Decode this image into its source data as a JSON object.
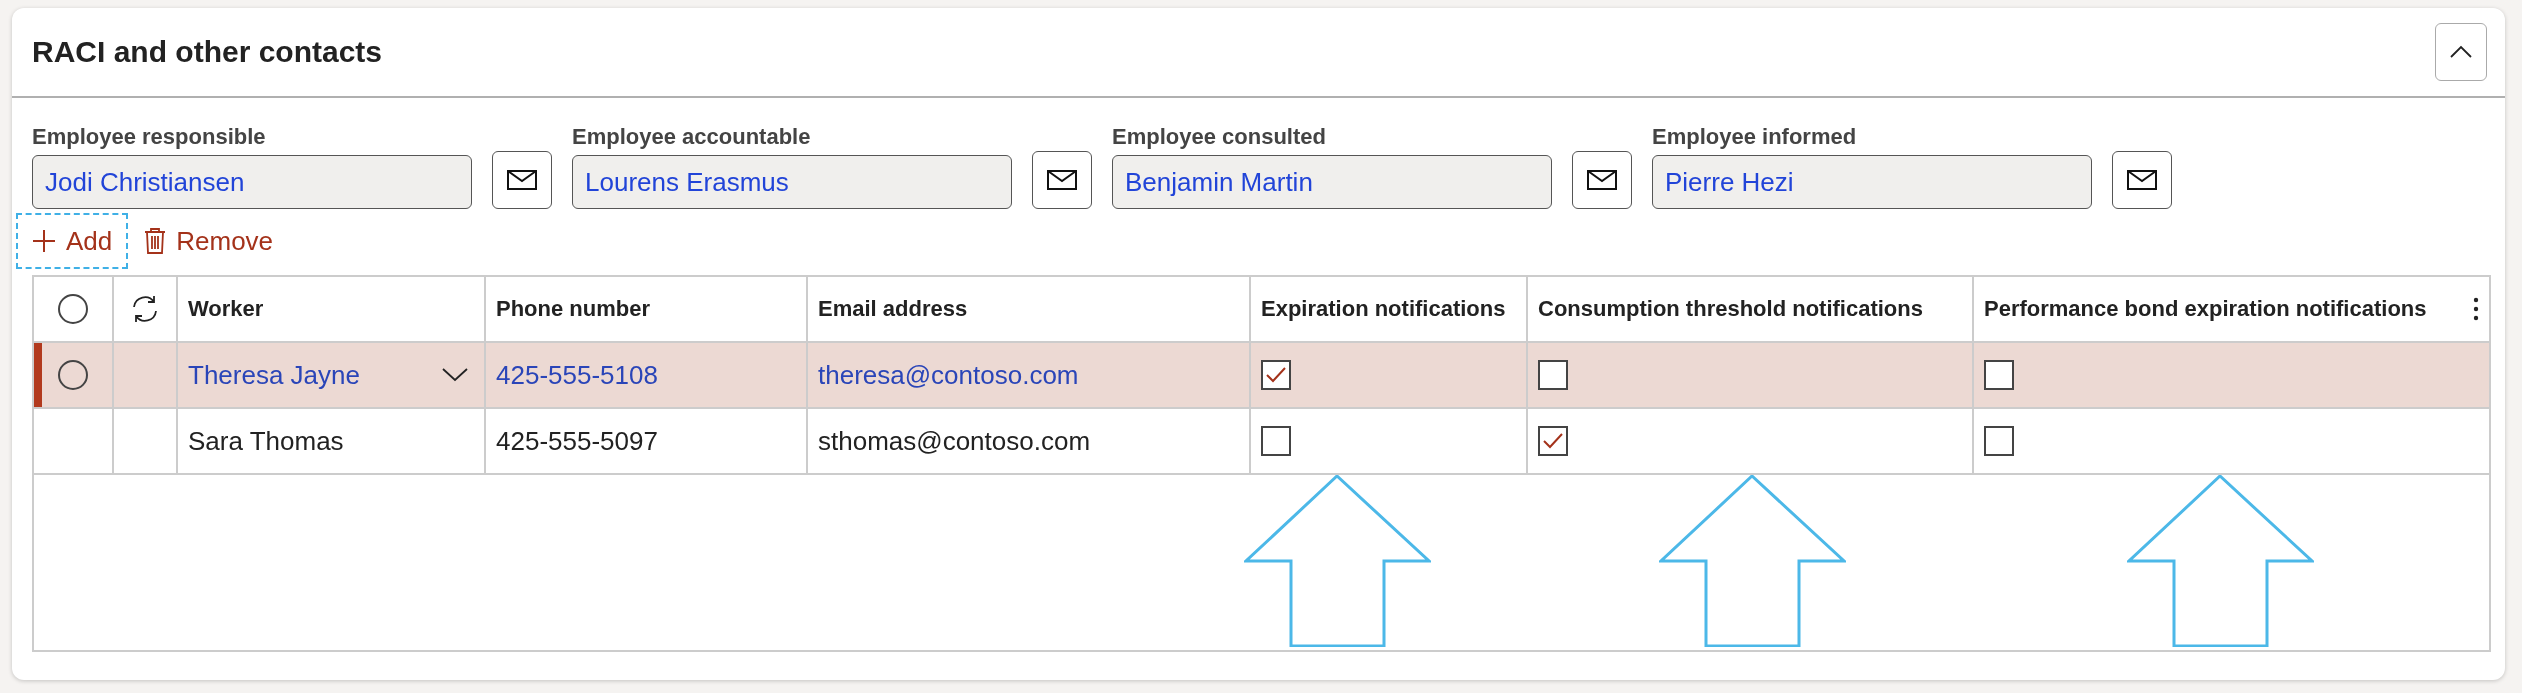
{
  "section": {
    "title": "RACI and other contacts",
    "expanded": true
  },
  "contacts": [
    {
      "label": "Employee responsible",
      "value": "Jodi Christiansen"
    },
    {
      "label": "Employee accountable",
      "value": "Lourens Erasmus"
    },
    {
      "label": "Employee consulted",
      "value": "Benjamin Martin"
    },
    {
      "label": "Employee informed",
      "value": "Pierre Hezi"
    }
  ],
  "actions": [
    {
      "kind": "add",
      "label": "Add",
      "focused": true
    },
    {
      "kind": "remove",
      "label": "Remove",
      "focused": false
    }
  ],
  "table": {
    "all_selected": false,
    "columns": [
      "Worker",
      "Phone number",
      "Email address",
      "Expiration notifications",
      "Consumption threshold notifications",
      "Performance bond expiration notifications"
    ],
    "rows": [
      {
        "selected": true,
        "worker": "Theresa Jayne",
        "phone": "425-555-5108",
        "email": "theresa@contoso.com",
        "expiration": true,
        "consumption": false,
        "performance_bond": false
      },
      {
        "selected": false,
        "worker": "Sara Thomas",
        "phone": "425-555-5097",
        "email": "sthomas@contoso.com",
        "expiration": false,
        "consumption": true,
        "performance_bond": false
      }
    ]
  }
}
